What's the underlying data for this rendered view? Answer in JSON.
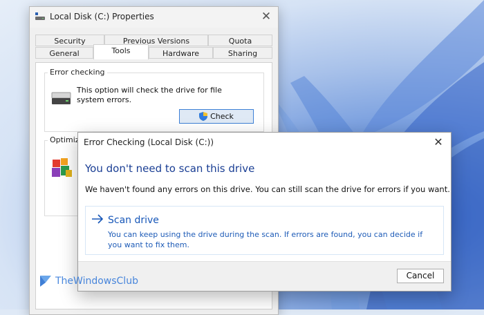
{
  "properties_window": {
    "title": "Local Disk (C:) Properties",
    "tabs_row1": [
      {
        "label": "Security"
      },
      {
        "label": "Previous Versions"
      },
      {
        "label": "Quota"
      }
    ],
    "tabs_row2": [
      {
        "label": "General"
      },
      {
        "label": "Tools",
        "active": true
      },
      {
        "label": "Hardware"
      },
      {
        "label": "Sharing"
      }
    ],
    "error_checking": {
      "group_title": "Error checking",
      "description": "This option will check the drive for file system errors.",
      "check_button": "Check"
    },
    "optimize": {
      "group_title": "Optimize"
    }
  },
  "dialog": {
    "title": "Error Checking (Local Disk (C:))",
    "heading": "You don't need to scan this drive",
    "message": "We haven't found any errors on this drive. You can still scan the drive for errors if you want.",
    "scan_option": {
      "label": "Scan drive",
      "description": "You can keep using the drive during the scan. If errors are found, you can decide if you want to fix them."
    },
    "cancel_button": "Cancel"
  },
  "watermark": {
    "text": "TheWindowsClub"
  },
  "colors": {
    "accent": "#1a3e94",
    "link": "#1656b8",
    "wallpaper": "#3f6fd0"
  },
  "icons": [
    "close-icon",
    "drive-icon",
    "shield-icon",
    "defrag-icon",
    "arrow-right-icon",
    "windows-club-logo-icon"
  ]
}
